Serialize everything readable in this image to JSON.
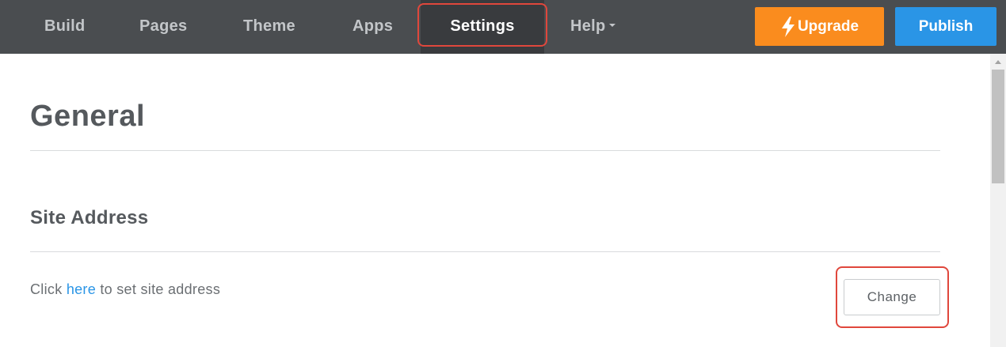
{
  "nav": {
    "tabs": [
      {
        "label": "Build"
      },
      {
        "label": "Pages"
      },
      {
        "label": "Theme"
      },
      {
        "label": "Apps"
      },
      {
        "label": "Settings",
        "active": true
      },
      {
        "label": "Help",
        "has_dropdown": true
      }
    ],
    "upgrade_label": "Upgrade",
    "upgrade_icon": "lightning-bolt-icon",
    "publish_label": "Publish"
  },
  "main": {
    "title": "General",
    "section_title": "Site Address",
    "description_prefix": "Click ",
    "description_link": "here",
    "description_suffix": " to set site address",
    "change_label": "Change"
  },
  "colors": {
    "topbar": "#4a4d50",
    "active_tab": "#393b3e",
    "upgrade": "#fa8c1e",
    "publish": "#2a95e6",
    "highlight": "#e0473c",
    "link": "#2a95e6"
  }
}
